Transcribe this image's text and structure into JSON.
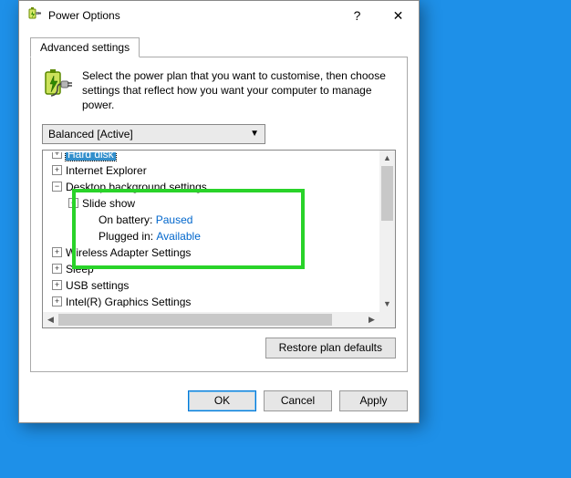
{
  "window": {
    "title": "Power Options",
    "help": "?",
    "close": "✕"
  },
  "tab": {
    "label": "Advanced settings"
  },
  "intro": "Select the power plan that you want to customise, then choose settings that reflect how you want your computer to manage power.",
  "plan": {
    "selected": "Balanced [Active]"
  },
  "tree": {
    "items": [
      {
        "label": "Hard disk",
        "exp": "+",
        "level": 0,
        "selected": true
      },
      {
        "label": "Internet Explorer",
        "exp": "+",
        "level": 0
      },
      {
        "label": "Desktop background settings",
        "exp": "−",
        "level": 0
      },
      {
        "label": "Slide show",
        "exp": "−",
        "level": 1
      },
      {
        "label_key": "On battery:",
        "label_val": "Paused",
        "level": 2,
        "link": true
      },
      {
        "label_key": "Plugged in:",
        "label_val": "Available",
        "level": 2,
        "link": true
      },
      {
        "label": "Wireless Adapter Settings",
        "exp": "+",
        "level": 0
      },
      {
        "label": "Sleep",
        "exp": "+",
        "level": 0
      },
      {
        "label": "USB settings",
        "exp": "+",
        "level": 0
      },
      {
        "label": "Intel(R) Graphics Settings",
        "exp": "+",
        "level": 0
      }
    ]
  },
  "buttons": {
    "restore": "Restore plan defaults",
    "ok": "OK",
    "cancel": "Cancel",
    "apply": "Apply"
  }
}
